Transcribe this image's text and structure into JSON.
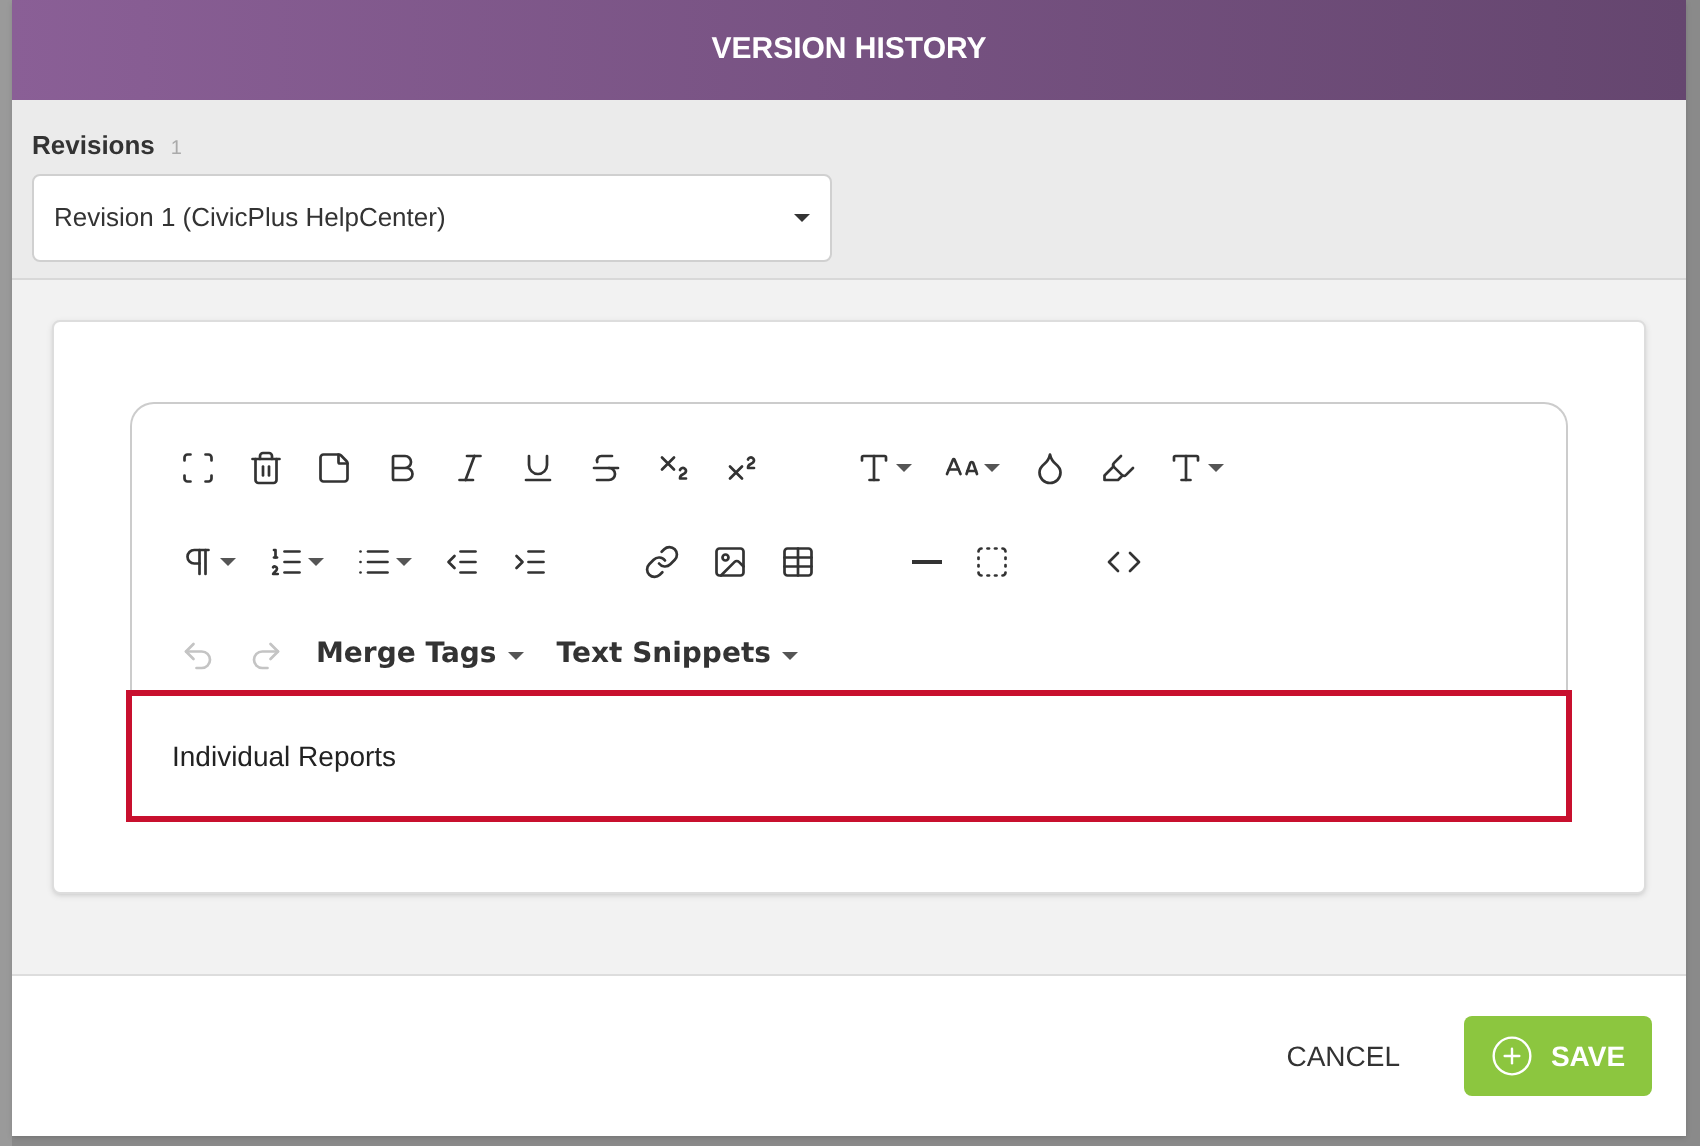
{
  "window": {
    "title": "VERSION HISTORY"
  },
  "revisions": {
    "label": "Revisions",
    "count": "1",
    "value": "Revision 1 (CivicPlus HelpCenter)"
  },
  "toolbar": [
    [
      [
        {
          "kind": "fullscreen"
        },
        {
          "kind": "trash"
        },
        {
          "kind": "note"
        },
        {
          "kind": "bold"
        },
        {
          "kind": "italic"
        },
        {
          "kind": "underline"
        },
        {
          "kind": "strike"
        },
        {
          "kind": "subscript"
        },
        {
          "kind": "superscript"
        }
      ],
      [
        {
          "kind": "font"
        },
        {
          "kind": "fontsize"
        },
        {
          "kind": "color"
        },
        {
          "kind": "highlight"
        },
        {
          "kind": "style"
        }
      ]
    ],
    [
      [
        {
          "kind": "paragraph"
        },
        {
          "kind": "ordered"
        },
        {
          "kind": "unordered"
        },
        {
          "kind": "outdent"
        },
        {
          "kind": "indent"
        }
      ],
      [
        {
          "kind": "link"
        },
        {
          "kind": "image"
        },
        {
          "kind": "table"
        }
      ],
      [
        {
          "kind": "rule"
        },
        {
          "kind": "select"
        }
      ],
      [
        {
          "kind": "code"
        }
      ]
    ]
  ],
  "history": [
    {
      "kind": "undo",
      "disabled": true
    },
    {
      "kind": "redo",
      "disabled": true
    }
  ],
  "menus": [
    "Merge Tags",
    "Text Snippets"
  ],
  "editor": {
    "text": "Individual Reports"
  },
  "buttons": {
    "cancel": "CANCEL",
    "save": "SAVE"
  }
}
